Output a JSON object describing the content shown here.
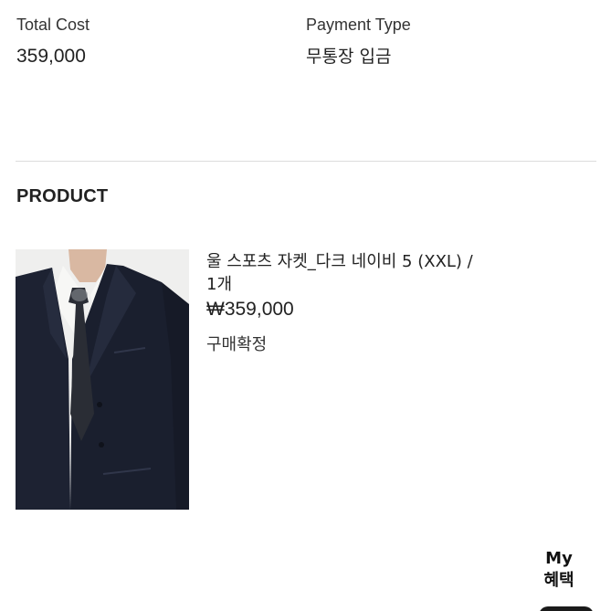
{
  "order_summary": {
    "total_cost_label": "Total Cost",
    "total_cost_value": "359,000",
    "payment_type_label": "Payment Type",
    "payment_type_value": "무통장 입금"
  },
  "product_section": {
    "title": "PRODUCT",
    "item": {
      "image_alt": "wool sport jacket",
      "name_line1": "울 스포츠 자켓_다크 네이비 5 (XXL) /",
      "name_line2": "1개",
      "price": "₩359,000",
      "status": "구매확정"
    }
  },
  "benefit_button": {
    "line1": "My",
    "line2": "혜택"
  },
  "colors": {
    "text": "#222222",
    "divider": "#dcdcdc",
    "jacket": "#1c2131"
  }
}
